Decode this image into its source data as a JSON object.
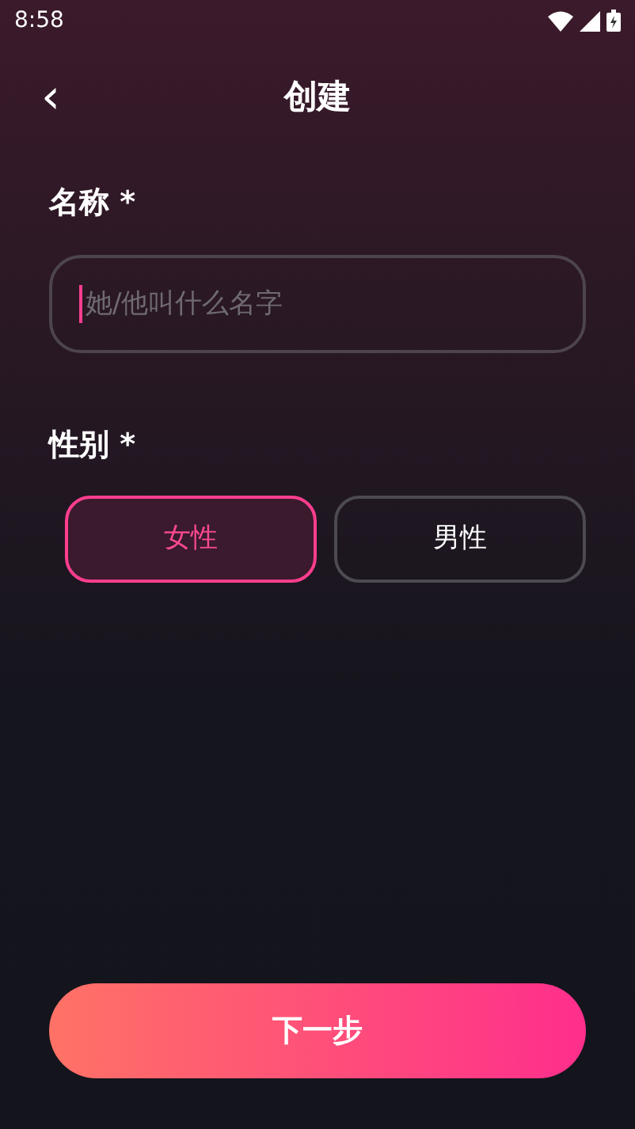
{
  "status_bar": {
    "time": "8:58"
  },
  "header": {
    "back": "‹",
    "title": "创建"
  },
  "name_field": {
    "label": "名称 *",
    "placeholder": "她/他叫什么名字",
    "focused": true
  },
  "gender": {
    "label": "性别 *",
    "options": [
      {
        "label": "女性",
        "selected": true
      },
      {
        "label": "男性",
        "selected": false
      }
    ]
  },
  "next_button": {
    "label": "下一步"
  }
}
